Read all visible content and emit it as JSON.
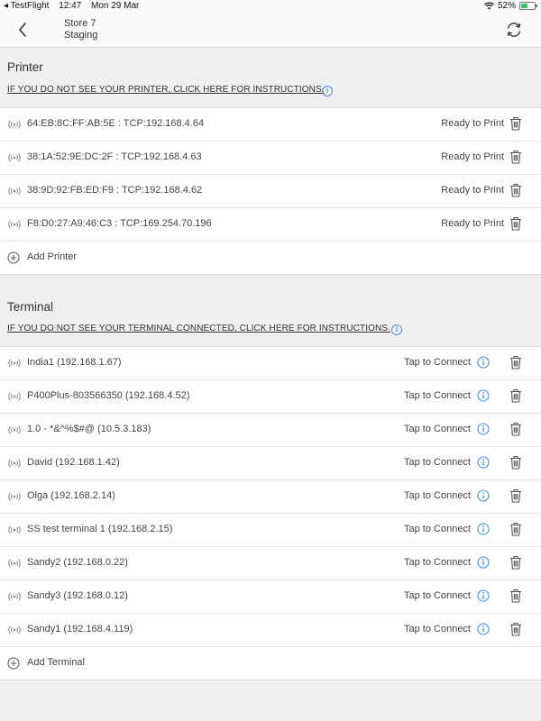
{
  "status_bar": {
    "back_app": "◂ TestFlight",
    "time": "12:47",
    "date": "Mon 29 Mar",
    "battery": "52%",
    "battery_level": 0.52
  },
  "nav": {
    "store": "Store 7",
    "env": "Staging"
  },
  "printer": {
    "title": "Printer",
    "help_link": "IF YOU DO NOT SEE YOUR PRINTER, CLICK HERE FOR INSTRUCTIONS.",
    "items": [
      {
        "label": "64:EB:8C:FF:AB:5E : TCP:192.168.4.64",
        "status": "Ready to Print"
      },
      {
        "label": "38:1A:52:9E:DC:2F : TCP:192.168.4.63",
        "status": "Ready to Print"
      },
      {
        "label": "38:9D:92:FB:ED:F9 : TCP:192.168.4.62",
        "status": "Ready to Print"
      },
      {
        "label": "F8:D0:27:A9:46:C3 : TCP:169.254.70.196",
        "status": "Ready to Print"
      }
    ],
    "add_label": "Add Printer"
  },
  "terminal": {
    "title": "Terminal",
    "help_link": "IF YOU DO NOT SEE YOUR TERMINAL CONNECTED, CLICK HERE FOR INSTRUCTIONS.",
    "items": [
      {
        "label": "India1 (192.168.1.67)",
        "status": "Tap to Connect"
      },
      {
        "label": "P400Plus-803566350 (192.168.4.52)",
        "status": "Tap to Connect"
      },
      {
        "label": "1.0 - *&^%$#@ (10.5.3.183)",
        "status": "Tap to Connect"
      },
      {
        "label": "David (192.168.1.42)",
        "status": "Tap to Connect"
      },
      {
        "label": "Olga (192.168.2.14)",
        "status": "Tap to Connect"
      },
      {
        "label": "SS test terminal 1 (192.168.2.15)",
        "status": "Tap to Connect"
      },
      {
        "label": "Sandy2 (192.168.0.22)",
        "status": "Tap to Connect"
      },
      {
        "label": "Sandy3 (192.168.0.12)",
        "status": "Tap to Connect"
      },
      {
        "label": "Sandy1 (192.168.4.119)",
        "status": "Tap to Connect"
      }
    ],
    "add_label": "Add Terminal"
  },
  "colors": {
    "background": "#efefef",
    "accent_info": "#4a8fd8",
    "battery_green": "#34c759"
  }
}
